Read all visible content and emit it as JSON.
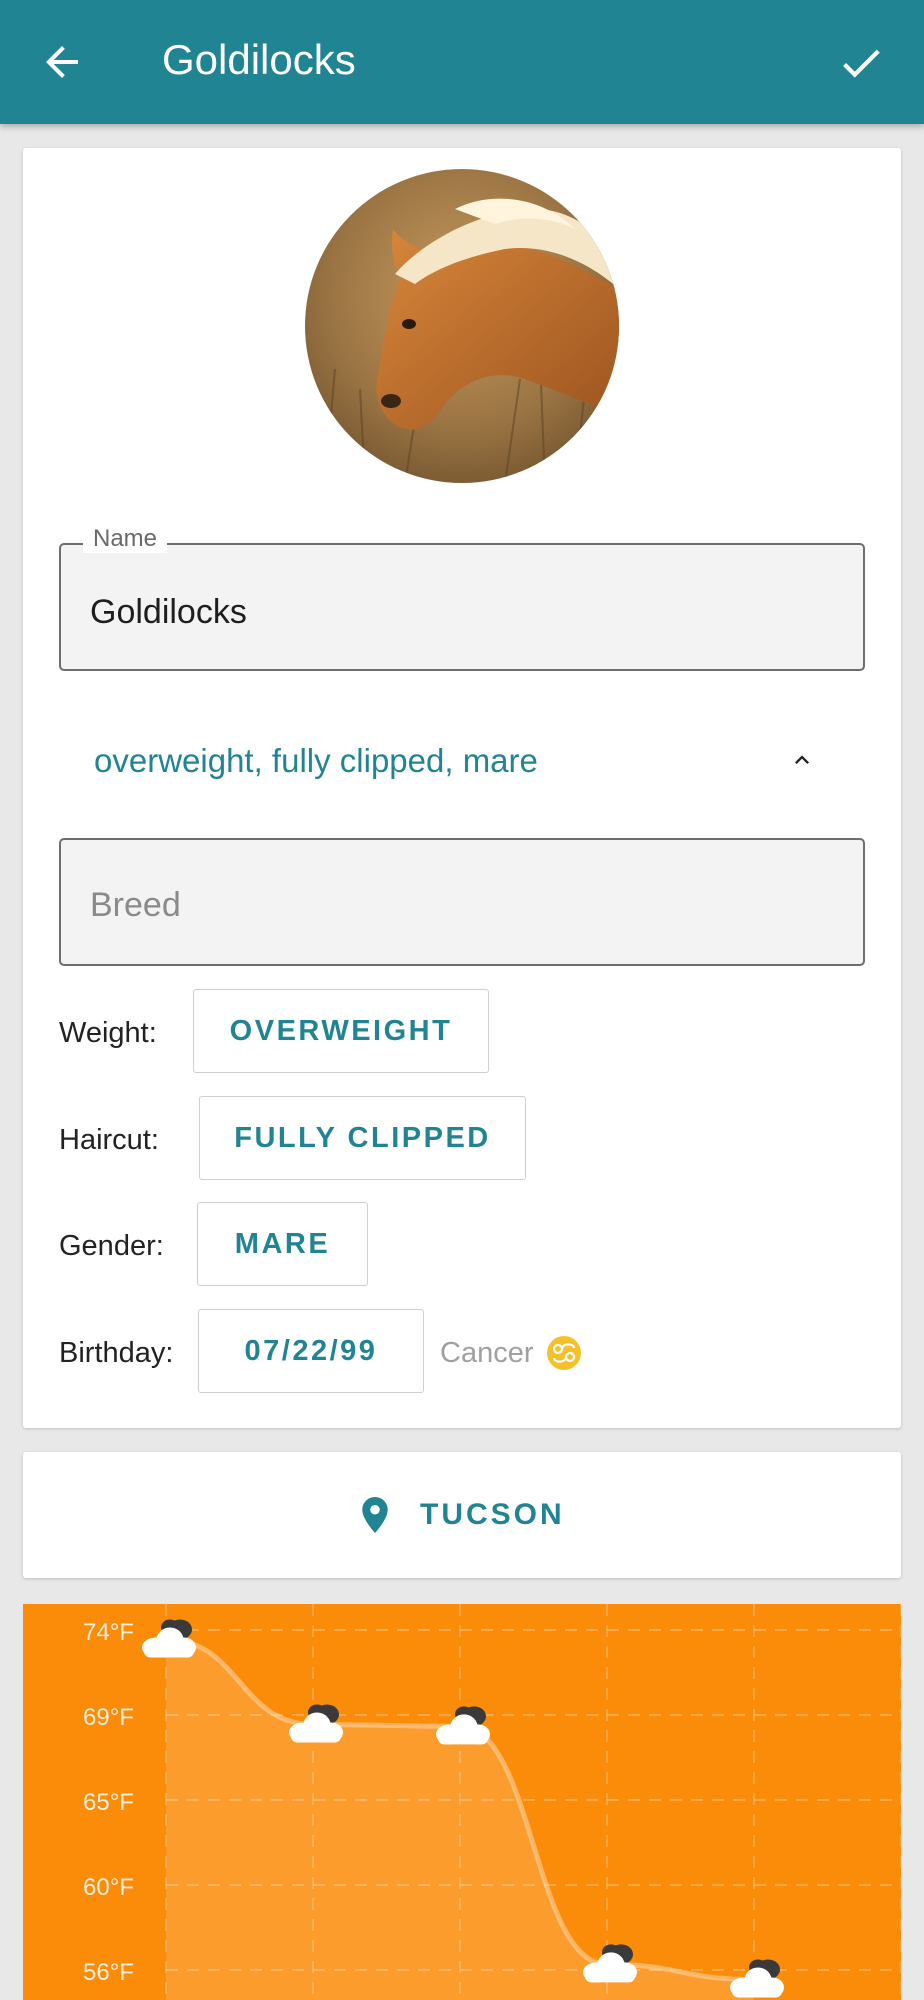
{
  "app_bar": {
    "title": "Goldilocks",
    "back_icon": "arrow-left-icon",
    "confirm_icon": "check-icon",
    "color": "#218493"
  },
  "profile": {
    "photo_alt": "horse-photo"
  },
  "name_field": {
    "label": "Name",
    "value": "Goldilocks"
  },
  "summary": {
    "text": "overweight, fully clipped, mare",
    "icon": "chevron-up-icon"
  },
  "breed_field": {
    "placeholder": "Breed"
  },
  "attributes": {
    "weight": {
      "label": "Weight:",
      "value": "OVERWEIGHT"
    },
    "haircut": {
      "label": "Haircut:",
      "value": "FULLY CLIPPED"
    },
    "gender": {
      "label": "Gender:",
      "value": "MARE"
    },
    "birthday": {
      "label": "Birthday:",
      "value": "07/22/99",
      "sign": "Cancer",
      "sign_icon": "cancer-zodiac-icon"
    }
  },
  "location": {
    "label": "TUCSON",
    "icon": "location-pin-icon"
  },
  "chart_data": {
    "type": "area",
    "y_tick_labels": [
      "74°F",
      "69°F",
      "65°F",
      "60°F",
      "56°F"
    ],
    "y_ticks": [
      74,
      69,
      65,
      60,
      56
    ],
    "ylim": [
      56,
      74
    ],
    "values": [
      73.5,
      69.0,
      68.9,
      56.3,
      55.5
    ],
    "point_icon": "partly-cloudy-icon",
    "grid": true,
    "background": "#fb8c0a"
  }
}
